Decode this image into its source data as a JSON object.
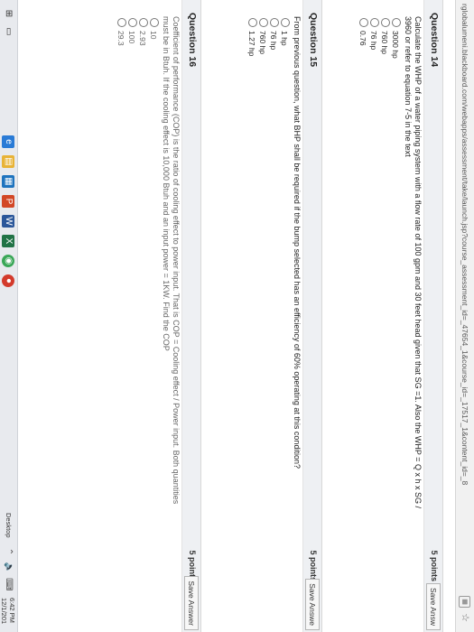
{
  "browser": {
    "url": "rglobalumeni.blackboard.com/webapps/assessment/take/launch.jsp?course_assessment_id=_47654_1&course_id=_17517_1&content_id=_8"
  },
  "questions": [
    {
      "title": "Question 14",
      "points": "5 points",
      "save_label": "Save Answ",
      "text_lines": [
        "Calculate the WHP of a water piping system with a flow rate of 100 gpm and 30 feet head given that SG =1. Also the WHP = Q x h x SG /",
        "3960 or refer to equation 7-5 in the text"
      ],
      "options": [
        "3000 hp",
        "760 hp",
        "76 hp",
        "0.76"
      ]
    },
    {
      "title": "Question 15",
      "points": "5 points",
      "save_label": "Save Answe",
      "text_lines": [
        "From previous question, what BHP shall be required if the bump selected has an efficiency of 60% operating at this condition?"
      ],
      "options": [
        "1 hp",
        "76 hp",
        "760 hp",
        "1.27 hp"
      ]
    },
    {
      "title": "Question 16",
      "points": "5 points",
      "save_label": "Save Answer",
      "text_lines": [
        "Coefficient of performance (COP) is the ratio of cooling effect to power input. That is COP = Cooling effect / Power input. Both quantities",
        "must be in Btuh. If the cooling effect is 10,000 Btuh and an input power = 1KW. Find the COP"
      ],
      "options": [
        "10",
        "2.93",
        "100",
        "29.3"
      ]
    }
  ],
  "taskbar": {
    "desktop_label": "Desktop",
    "time": "6:42 PM",
    "date": "12/1/201"
  },
  "colors": {
    "accent": "#2a7bd6",
    "chrome_green": "#3aa757",
    "chrome_red": "#d33b2c"
  }
}
